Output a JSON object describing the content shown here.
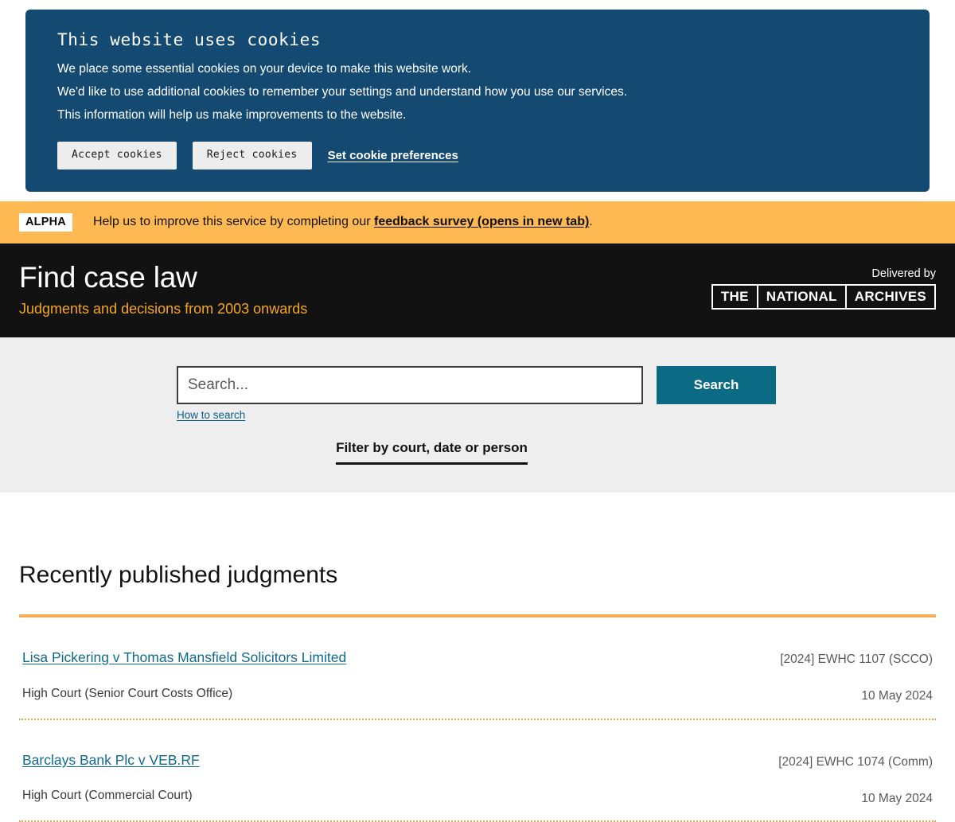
{
  "cookie_banner": {
    "title": "This website uses cookies",
    "paragraphs": [
      "We place some essential cookies on your device to make this website work.",
      "We'd like to use additional cookies to remember your settings and understand how you use our services.",
      "This information will help us make improvements to the website."
    ],
    "accept_label": "Accept cookies",
    "reject_label": "Reject cookies",
    "preferences_label": "Set cookie preferences",
    "background_color": "#144a72"
  },
  "alpha_banner": {
    "badge": "ALPHA",
    "text_before": "Help us to improve this service by completing our ",
    "link_text": "feedback survey (opens in new tab)",
    "text_after": ".",
    "background_color": "#ffb953"
  },
  "header": {
    "title": "Find case law",
    "subtitle": "Judgments and decisions from 2003 onwards",
    "subtitle_color": "#f5a623",
    "delivered_by_label": "Delivered by",
    "logo_words": [
      "THE",
      "NATIONAL",
      "ARCHIVES"
    ],
    "background_color": "#121212"
  },
  "search": {
    "value": "",
    "placeholder": "Search...",
    "button_label": "Search",
    "button_color": "#0b6b84",
    "how_to_search_label": "How to search",
    "filter_label": "Filter by court, date or person",
    "band_color": "#eeeeee"
  },
  "recent": {
    "heading": "Recently published judgments",
    "rule_color": "#f5ad56",
    "items": [
      {
        "title": "Lisa Pickering v Thomas Mansfield Solicitors Limited",
        "court": "High Court (Senior Court Costs Office)",
        "citation": "[2024] EWHC 1107 (SCCO)",
        "date": "10 May 2024"
      },
      {
        "title": "Barclays Bank Plc v VEB.RF",
        "court": "High Court (Commercial Court)",
        "citation": "[2024] EWHC 1074 (Comm)",
        "date": "10 May 2024"
      }
    ]
  }
}
